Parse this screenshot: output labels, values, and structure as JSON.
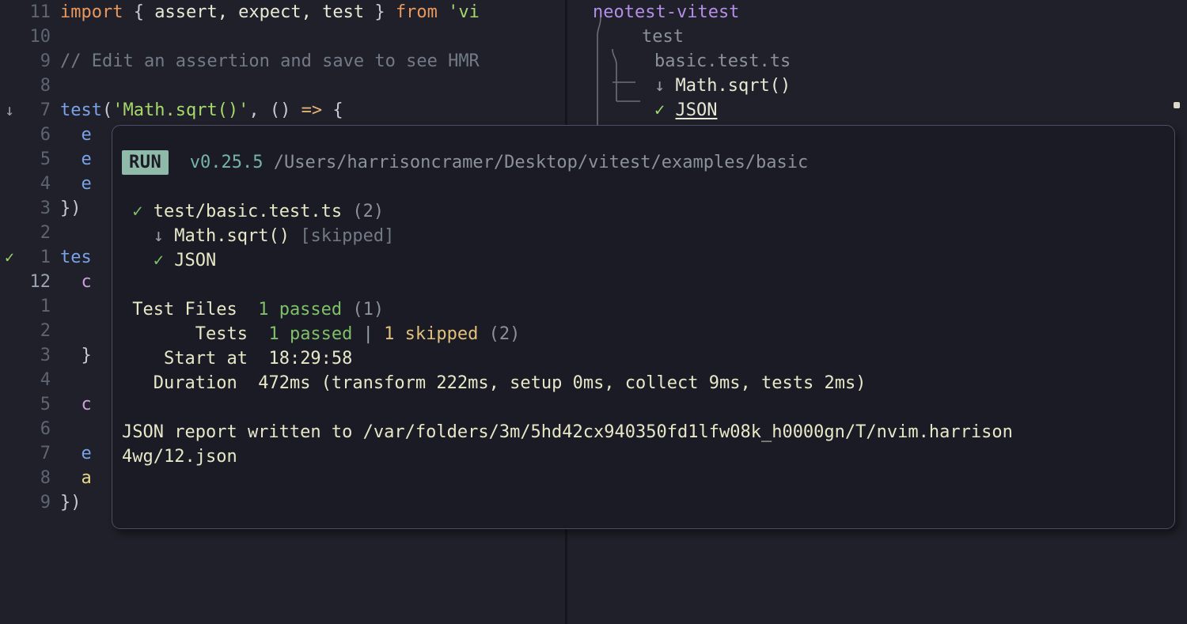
{
  "editor": {
    "lines": [
      {
        "sign": "",
        "num": "11",
        "cur": false,
        "tokens": [
          {
            "t": "import ",
            "c": "tk-kw"
          },
          {
            "t": "{ ",
            "c": "tk-punct"
          },
          {
            "t": "assert, expect, test",
            "c": "tk-ident"
          },
          {
            "t": " } ",
            "c": "tk-punct"
          },
          {
            "t": "from ",
            "c": "tk-kw"
          },
          {
            "t": "'vi",
            "c": "tk-str"
          }
        ]
      },
      {
        "sign": "",
        "num": "10",
        "cur": false,
        "tokens": []
      },
      {
        "sign": "",
        "num": "9",
        "cur": false,
        "tokens": [
          {
            "t": "// Edit an assertion and save to see HMR",
            "c": "tk-comment"
          }
        ]
      },
      {
        "sign": "",
        "num": "8",
        "cur": false,
        "tokens": []
      },
      {
        "sign": "skip",
        "num": "7",
        "cur": false,
        "tokens": [
          {
            "t": "test",
            "c": "tk-fn"
          },
          {
            "t": "(",
            "c": "tk-punct"
          },
          {
            "t": "'Math.sqrt()'",
            "c": "tk-str"
          },
          {
            "t": ", ",
            "c": "tk-punct"
          },
          {
            "t": "()",
            "c": "tk-punct"
          },
          {
            "t": " => ",
            "c": "tk-arrow"
          },
          {
            "t": "{",
            "c": "tk-punct"
          }
        ]
      },
      {
        "sign": "",
        "num": "6",
        "cur": false,
        "tokens": [
          {
            "t": "  ",
            "c": "tk-ident"
          },
          {
            "t": "e",
            "c": "tk-fn"
          }
        ]
      },
      {
        "sign": "",
        "num": "5",
        "cur": false,
        "tokens": [
          {
            "t": "  ",
            "c": "tk-ident"
          },
          {
            "t": "e",
            "c": "tk-fn"
          }
        ]
      },
      {
        "sign": "",
        "num": "4",
        "cur": false,
        "tokens": [
          {
            "t": "  ",
            "c": "tk-ident"
          },
          {
            "t": "e",
            "c": "tk-fn"
          }
        ]
      },
      {
        "sign": "",
        "num": "3",
        "cur": false,
        "tokens": [
          {
            "t": "})",
            "c": "tk-punct"
          }
        ]
      },
      {
        "sign": "",
        "num": "2",
        "cur": false,
        "tokens": []
      },
      {
        "sign": "pass",
        "num": "1",
        "cur": false,
        "tokens": [
          {
            "t": "tes",
            "c": "tk-fn"
          }
        ]
      },
      {
        "sign": "",
        "num": "12",
        "cur": true,
        "tokens": [
          {
            "t": "  ",
            "c": "tk-ident"
          },
          {
            "t": "c",
            "c": "tk-prop"
          }
        ]
      },
      {
        "sign": "",
        "num": "1",
        "cur": false,
        "tokens": []
      },
      {
        "sign": "",
        "num": "2",
        "cur": false,
        "tokens": []
      },
      {
        "sign": "",
        "num": "3",
        "cur": false,
        "tokens": [
          {
            "t": "  }",
            "c": "tk-punct"
          }
        ]
      },
      {
        "sign": "",
        "num": "4",
        "cur": false,
        "tokens": []
      },
      {
        "sign": "",
        "num": "5",
        "cur": false,
        "tokens": [
          {
            "t": "  ",
            "c": "tk-ident"
          },
          {
            "t": "c",
            "c": "tk-prop"
          }
        ]
      },
      {
        "sign": "",
        "num": "6",
        "cur": false,
        "tokens": []
      },
      {
        "sign": "",
        "num": "7",
        "cur": false,
        "tokens": [
          {
            "t": "  ",
            "c": "tk-ident"
          },
          {
            "t": "e",
            "c": "tk-fn"
          }
        ]
      },
      {
        "sign": "",
        "num": "8",
        "cur": false,
        "tokens": [
          {
            "t": "  ",
            "c": "tk-ident"
          },
          {
            "t": "a",
            "c": "tk-const"
          }
        ]
      },
      {
        "sign": "",
        "num": "9",
        "cur": false,
        "tokens": [
          {
            "t": "})",
            "c": "tk-punct"
          }
        ]
      }
    ]
  },
  "tree": {
    "rows": [
      {
        "indent": 32,
        "icon": "",
        "icon_kind": "",
        "label": "neotest-vitest",
        "cls": "t-root"
      },
      {
        "indent": 94,
        "icon": "",
        "icon_kind": "",
        "label": "test",
        "cls": "t-dir"
      },
      {
        "indent": 110,
        "icon": "",
        "icon_kind": "",
        "label": "basic.test.ts",
        "cls": "t-file"
      },
      {
        "indent": 110,
        "icon": "↓",
        "icon_kind": "skip",
        "label": "Math.sqrt()",
        "cls": "t-test"
      },
      {
        "indent": 110,
        "icon": "✓",
        "icon_kind": "pass",
        "label": "JSON",
        "cls": "t-testu"
      }
    ]
  },
  "output": {
    "run_badge": "RUN",
    "version": "v0.25.5",
    "run_path": "/Users/harrisoncramer/Desktop/vitest/examples/basic",
    "file_check": "✓",
    "file_name": "test/basic.test.ts",
    "file_count": "(2)",
    "test_skip_icon": "↓",
    "test_skip_name": "Math.sqrt()",
    "test_skip_tag": "[skipped]",
    "test_pass_icon": "✓",
    "test_pass_name": "JSON",
    "files_label": "Test Files",
    "files_passed": "1 passed",
    "files_total": "(1)",
    "tests_label": "Tests",
    "tests_passed": "1 passed",
    "tests_divider": "|",
    "tests_skipped": "1 skipped",
    "tests_total": "(2)",
    "start_label": "Start at",
    "start_value": "18:29:58",
    "duration_label": "Duration",
    "duration_value": "472ms (transform 222ms, setup 0ms, collect 9ms, tests 2ms)",
    "json_report_line1": "JSON report written to /var/folders/3m/5hd42cx940350fd1lfw08k_h0000gn/T/nvim.harrison",
    "json_report_line2": "4wg/12.json"
  },
  "colors": {
    "background": "#1f2029",
    "panel_bg": "#1a1b24",
    "panel_border": "#4e4d68",
    "run_badge_bg": "#8fb9a8",
    "pass_green": "#7fc06a",
    "skip_gray": "#9aa0ab",
    "warn_yellow": "#e3c07b",
    "accent_purple": "#b48ee8",
    "teal": "#76b5a5"
  }
}
